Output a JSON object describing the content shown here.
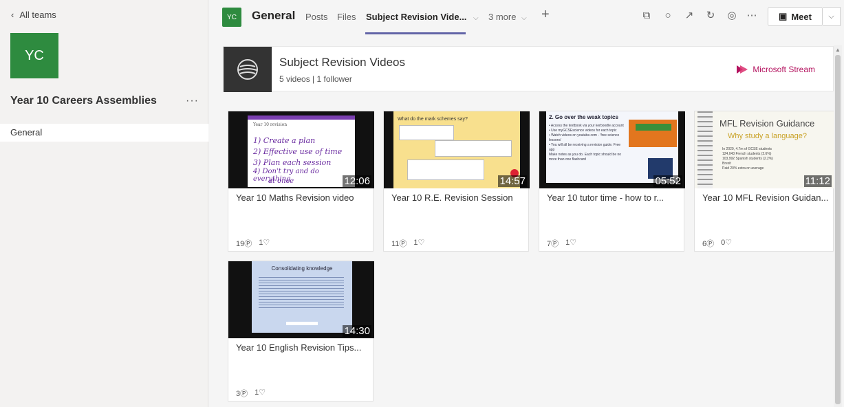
{
  "sidebar": {
    "back_label": "All teams",
    "team_initials": "YC",
    "team_name": "Year 10 Careers Assemblies",
    "more": "···",
    "channels": [
      "General"
    ]
  },
  "header": {
    "initials": "YC",
    "channel_title": "General",
    "tabs": [
      "Posts",
      "Files",
      "Subject Revision Vide...",
      "3 more"
    ],
    "meet_label": "Meet"
  },
  "stream": {
    "title": "Subject Revision Videos",
    "subtitle": "5 videos | 1 follower",
    "brand": "Microsoft Stream"
  },
  "videos": [
    {
      "title": "Year 10 Maths Revision video",
      "duration": "12:06",
      "views": "19",
      "likes": "1"
    },
    {
      "title": "Year 10 R.E. Revision Session",
      "duration": "14:57",
      "views": "11",
      "likes": "1"
    },
    {
      "title": "Year 10 tutor time - how to r...",
      "duration": "05:52",
      "views": "7",
      "likes": "1"
    },
    {
      "title": "Year 10 MFL Revision Guidan...",
      "duration": "11:12",
      "views": "6",
      "likes": "0"
    },
    {
      "title": "Year 10 English Revision Tips...",
      "duration": "14:30",
      "views": "3",
      "likes": "1"
    }
  ],
  "thumbs": {
    "v1_lines": [
      "Year 10 revision",
      "1) Create a plan",
      "2) Effective use of time",
      "3) Plan each session",
      "4) Don't try and do everything",
      "at once"
    ],
    "v2_heading": "What do the mark schemes say?",
    "v3_heading": "2. Go over the weak topics",
    "v3_bullets": [
      "• Access the textbook via your kerboodle account",
      "• Use myGCSEscience videos for each topic",
      "• Watch videos on youtube.com - 'free science lessons'",
      "• You will all be receiving a revision guide. Free app",
      "Make notes as you do. Each topic should be no more than one flashcard"
    ],
    "v4_heading": "MFL Revision Guidance",
    "v4_sub": "Why study a language?",
    "v4_bullets": [
      "In 2020, 4.7m of GCSE students",
      "124,043 French students (2.6%)",
      "103,992 Spanish students (2.2%)",
      "Brexit",
      "Paid 20% extra on average"
    ],
    "v5_heading": "Consolidating knowledge"
  },
  "colors": {
    "team": "#2e8b3f",
    "accent": "#6264a7",
    "stream": "#b4135f"
  }
}
